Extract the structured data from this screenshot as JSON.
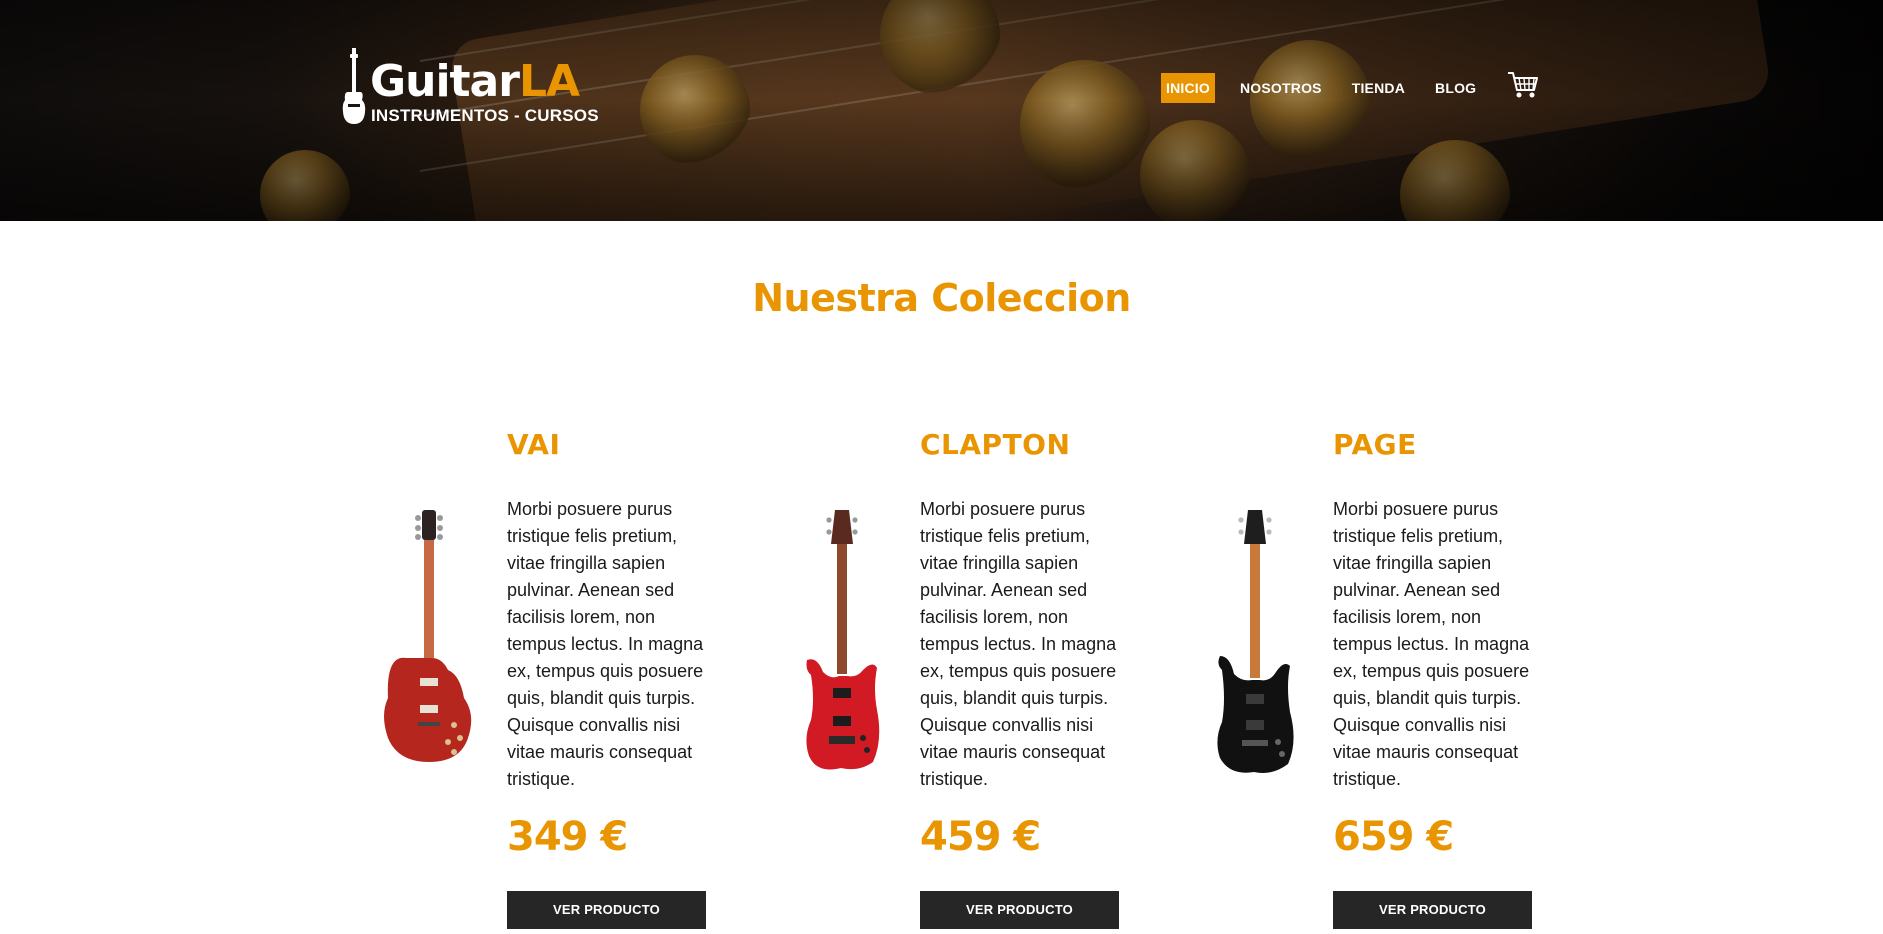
{
  "header": {
    "logo": {
      "brand_main": "Guitar",
      "brand_accent": "LA",
      "tagline": "INSTRUMENTOS - CURSOS"
    },
    "nav": [
      {
        "label": "INICIO",
        "active": true
      },
      {
        "label": "NOSOTROS",
        "active": false
      },
      {
        "label": "TIENDA",
        "active": false
      },
      {
        "label": "BLOG",
        "active": false
      }
    ],
    "cart_icon": "shopping-cart-icon"
  },
  "main": {
    "title": "Nuestra Coleccion",
    "products": [
      {
        "name": "VAI",
        "description": "Morbi posuere purus tristique felis pretium, vitae fringilla sapien pulvinar. Aenean sed facilisis lorem, non tempus lectus. In magna ex, tempus quis posuere quis, blandit quis turpis. Quisque convallis nisi vitae mauris consequat tristique.",
        "price": "349 €",
        "button": "VER PRODUCTO",
        "guitar_color": "#b5261e",
        "image": "red-les-paul-guitar"
      },
      {
        "name": "CLAPTON",
        "description": "Morbi posuere purus tristique felis pretium, vitae fringilla sapien pulvinar. Aenean sed facilisis lorem, non tempus lectus. In magna ex, tempus quis posuere quis, blandit quis turpis. Quisque convallis nisi vitae mauris consequat tristique.",
        "price": "459 €",
        "button": "VER PRODUCTO",
        "guitar_color": "#d11a24",
        "image": "red-superstrat-guitar"
      },
      {
        "name": "PAGE",
        "description": "Morbi posuere purus tristique felis pretium, vitae fringilla sapien pulvinar. Aenean sed facilisis lorem, non tempus lectus. In magna ex, tempus quis posuere quis, blandit quis turpis. Quisque convallis nisi vitae mauris consequat tristique.",
        "price": "659 €",
        "button": "VER PRODUCTO",
        "guitar_color": "#111111",
        "image": "black-superstrat-guitar"
      }
    ]
  },
  "colors": {
    "accent": "#e99401",
    "button": "#262626",
    "text": "#1a1a1a"
  }
}
